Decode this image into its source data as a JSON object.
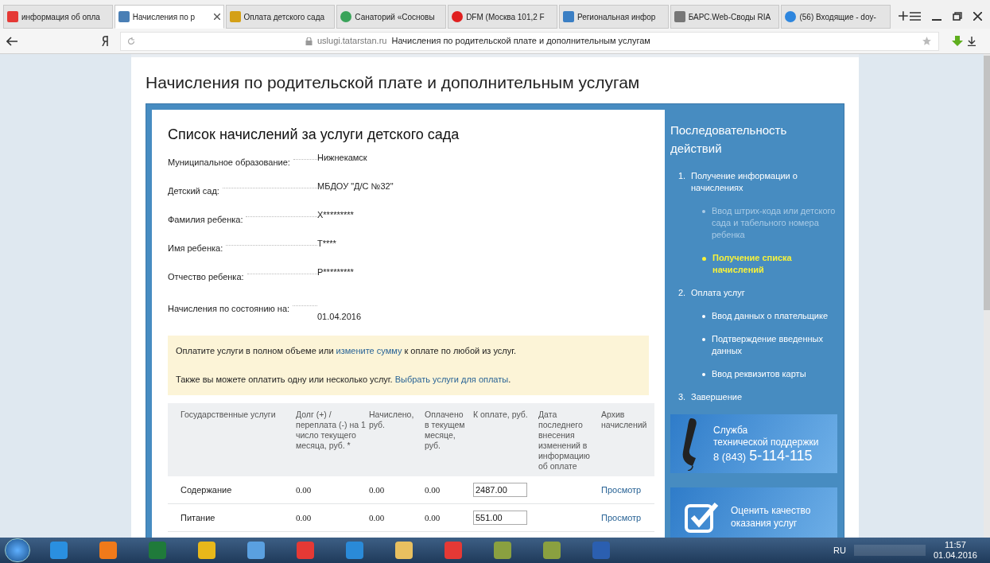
{
  "browser": {
    "tabs": [
      {
        "label": "информация об опла",
        "kind": "yandex",
        "selected": false
      },
      {
        "label": "Начисления по р",
        "kind": "site",
        "selected": true
      },
      {
        "label": "Оплата детского сада",
        "kind": "coin",
        "selected": false
      },
      {
        "label": "Санаторий «Сосновы",
        "kind": "globe",
        "selected": false
      },
      {
        "label": "DFM (Москва 101,2 F",
        "kind": "play",
        "selected": false
      },
      {
        "label": "Региональная инфор",
        "kind": "chart",
        "selected": false
      },
      {
        "label": "БАРС.Web-Своды RIA",
        "kind": "doc",
        "selected": false
      },
      {
        "label": "(56) Входящие - doy-",
        "kind": "mail",
        "selected": false
      }
    ],
    "address": {
      "domain": "uslugi.tatarstan.ru",
      "title": "Начисления по родительской плате и дополнительным услугам"
    }
  },
  "page": {
    "heading": "Начисления по родительской плате и дополнительным услугам",
    "panel_title": "Список начислений за услуги детского сада",
    "fields": [
      {
        "label": "Муниципальное образование:",
        "value": "Нижнекамск"
      },
      {
        "label": "Детский сад:",
        "value": "МБДОУ \"Д/С №32\""
      },
      {
        "label": "Фамилия ребенка:",
        "value": "Х*********"
      },
      {
        "label": "Имя ребенка:",
        "value": "Т****"
      },
      {
        "label": "Отчество ребенка:",
        "value": "Р*********"
      },
      {
        "label": "Начисления по состоянию на:",
        "value": "01.04.2016"
      }
    ],
    "notice": [
      [
        {
          "kind": "text",
          "text": "Оплатите услуги в полном объеме или "
        },
        {
          "kind": "link",
          "text": "измените сумму"
        },
        {
          "kind": "text",
          "text": " к оплате по любой из услуг."
        }
      ],
      [
        {
          "kind": "text",
          "text": "Также вы можете оплатить одну или несколько услуг. "
        },
        {
          "kind": "link",
          "text": "Выбрать услуги для оплаты"
        },
        {
          "kind": "text",
          "text": "."
        }
      ]
    ],
    "table": {
      "columns": [
        "Государственные услуги",
        "Долг (+) / переплата (-) на 1 число текущего месяца, руб. *",
        "Начислено, руб.",
        "Оплачено в текущем месяце, руб.",
        "К оплате, руб.",
        "Дата последнего внесения изменений в информацию об оплате",
        "Архив начислений"
      ],
      "rows": [
        {
          "service": "Содержание",
          "debt": "0.00",
          "charged": "0.00",
          "paid": "0.00",
          "to_pay": "2487.00",
          "link": "Просмотр"
        },
        {
          "service": "Питание",
          "debt": "0.00",
          "charged": "0.00",
          "paid": "0.00",
          "to_pay": "551.00",
          "link": "Просмотр"
        }
      ]
    }
  },
  "sidebar": {
    "title": "Последовательность действий",
    "steps": [
      {
        "number": "1.",
        "label": "Получение информации о начислениях",
        "children": [
          {
            "label": "Ввод штрих-кода или детского сада и табельного номера ребенка",
            "completed": true,
            "selected": false
          },
          {
            "label": "Получение списка начислений",
            "completed": false,
            "selected": true
          }
        ]
      },
      {
        "number": "2.",
        "label": "Оплата услуг",
        "children": [
          {
            "label": "Ввод данных о плательщике",
            "completed": false,
            "selected": false
          },
          {
            "label": "Подтверждение введенных данных",
            "completed": false,
            "selected": false
          },
          {
            "label": "Ввод реквизитов карты",
            "completed": false,
            "selected": false
          }
        ]
      },
      {
        "number": "3.",
        "label": "Завершение"
      }
    ],
    "support": {
      "title": "Служба",
      "subtitle": "технической поддержки",
      "code": "8 (843)",
      "phone": "5-114-115"
    },
    "rate": "Оценить качество оказания услуг"
  },
  "taskbar": {
    "language": "RU",
    "time": "11:57",
    "date": "01.04.2016"
  }
}
